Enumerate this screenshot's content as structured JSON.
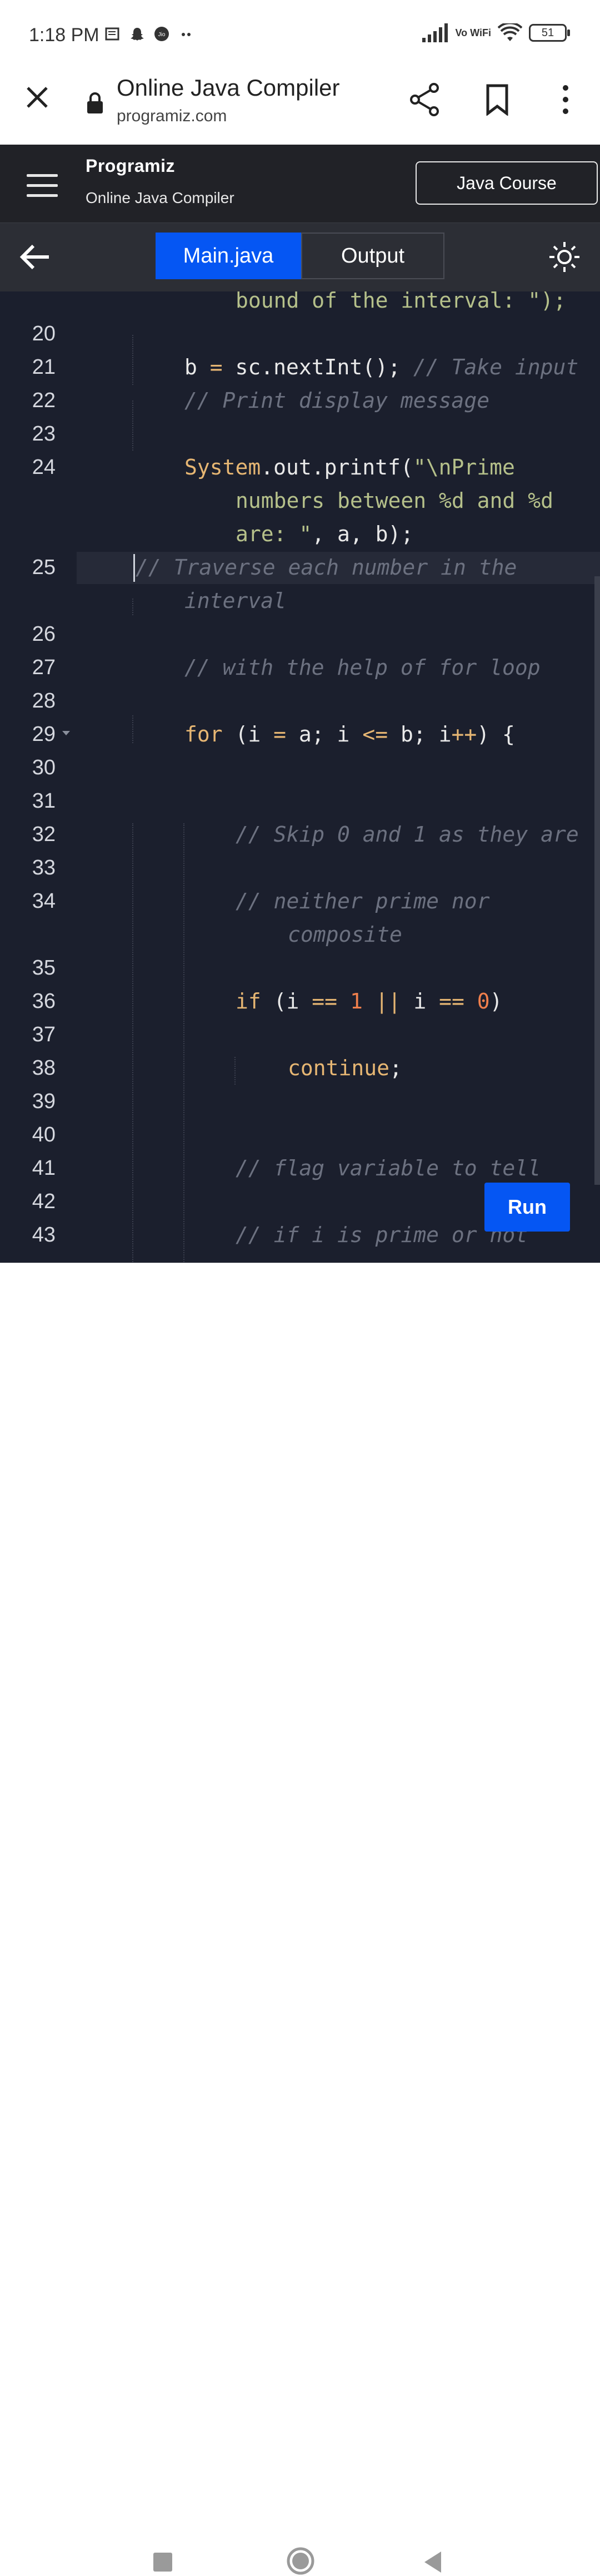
{
  "status_bar": {
    "time": "1:18 PM",
    "battery": "51",
    "network_label": "Vo WiFi"
  },
  "browser": {
    "title": "Online Java Compiler",
    "url": "programiz.com"
  },
  "site_header": {
    "logo_text": "Programiz",
    "subtitle": "Online Java Compiler",
    "course_button": "Java Course"
  },
  "tabs": {
    "main_label": "Main.java",
    "output_label": "Output"
  },
  "editor": {
    "overflow_text": "bound of the interval: \");",
    "lines": [
      {
        "n": "20",
        "text": ""
      },
      {
        "n": "21",
        "text": "b = sc.nextInt(); // Take input"
      },
      {
        "n": "22",
        "text": "// Print display message"
      },
      {
        "n": "23",
        "text": ""
      },
      {
        "n": "24",
        "text": "System.out.printf(\"\\nPrime numbers between %d and %d are: \", a, b);"
      },
      {
        "n": "25",
        "text": "// Traverse each number in the interval"
      },
      {
        "n": "26",
        "text": ""
      },
      {
        "n": "27",
        "text": "// with the help of for loop"
      },
      {
        "n": "28",
        "text": ""
      },
      {
        "n": "29",
        "text": "for (i = a; i <= b; i++) {"
      },
      {
        "n": "30",
        "text": ""
      },
      {
        "n": "31",
        "text": ""
      },
      {
        "n": "32",
        "text": "// Skip 0 and 1 as they are"
      },
      {
        "n": "33",
        "text": ""
      },
      {
        "n": "34",
        "text": "// neither prime nor composite"
      },
      {
        "n": "35",
        "text": ""
      },
      {
        "n": "36",
        "text": "if (i == 1 || i == 0)"
      },
      {
        "n": "37",
        "text": ""
      },
      {
        "n": "38",
        "text": "continue;"
      },
      {
        "n": "39",
        "text": ""
      },
      {
        "n": "40",
        "text": ""
      },
      {
        "n": "41",
        "text": "// flag variable to tell"
      },
      {
        "n": "42",
        "text": ""
      },
      {
        "n": "43",
        "text": "// if i is prime or not"
      }
    ]
  },
  "run_button": "Run"
}
